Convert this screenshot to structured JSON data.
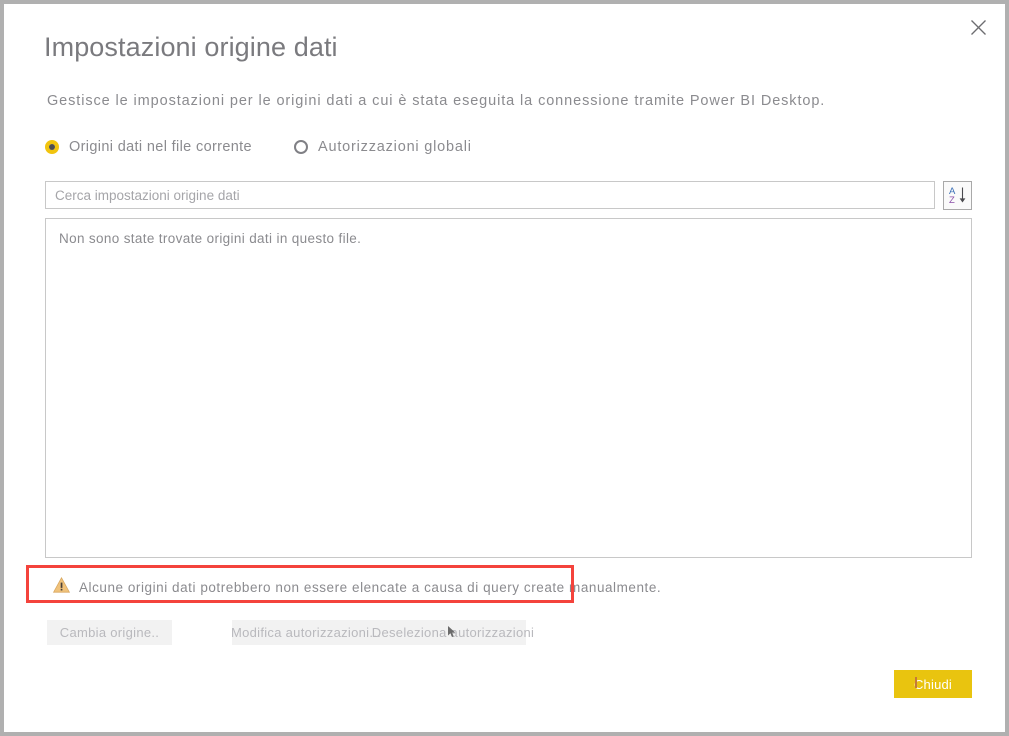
{
  "window": {
    "title": "Impostazioni origine dati",
    "subtitle": "Gestisce le impostazioni per le origini dati a cui è stata eseguita la connessione tramite Power BI Desktop.",
    "close_icon": "close-icon"
  },
  "scope": {
    "options": [
      {
        "label": "Origini dati nel file corrente",
        "selected": true
      },
      {
        "label": "Autorizzazioni globali",
        "selected": false
      }
    ]
  },
  "search": {
    "placeholder": "Cerca impostazioni origine dati",
    "value": "",
    "sort_icon": "sort-az-icon",
    "sort_icon_letters": {
      "top": "A",
      "bottom": "Z"
    }
  },
  "list": {
    "empty_message": "Non sono state trovate origini dati in questo file.",
    "items": []
  },
  "warning": {
    "icon": "warning-triangle-icon",
    "text": "Alcune origini dati potrebbero non essere elencate a causa di query create manualmente."
  },
  "actions": {
    "change_source": "Cambia origine..",
    "edit_permissions": "Modifica autorizzazioni...",
    "clear_permissions": "Deseleziona autorizzazioni",
    "close": "Chiudi"
  },
  "colors": {
    "accent_gold": "#e9c40f",
    "radio_selected_ring": "#f1c40f",
    "text_gray": "#8b8b8f",
    "title_gray": "#7a7a7e",
    "annotation_red": "#f4433c",
    "warning_amber": "#f0c27b",
    "sort_letter_a": "#3b6fb6",
    "sort_letter_z": "#8a4fa8",
    "frame_border": "#b0b0b0"
  }
}
